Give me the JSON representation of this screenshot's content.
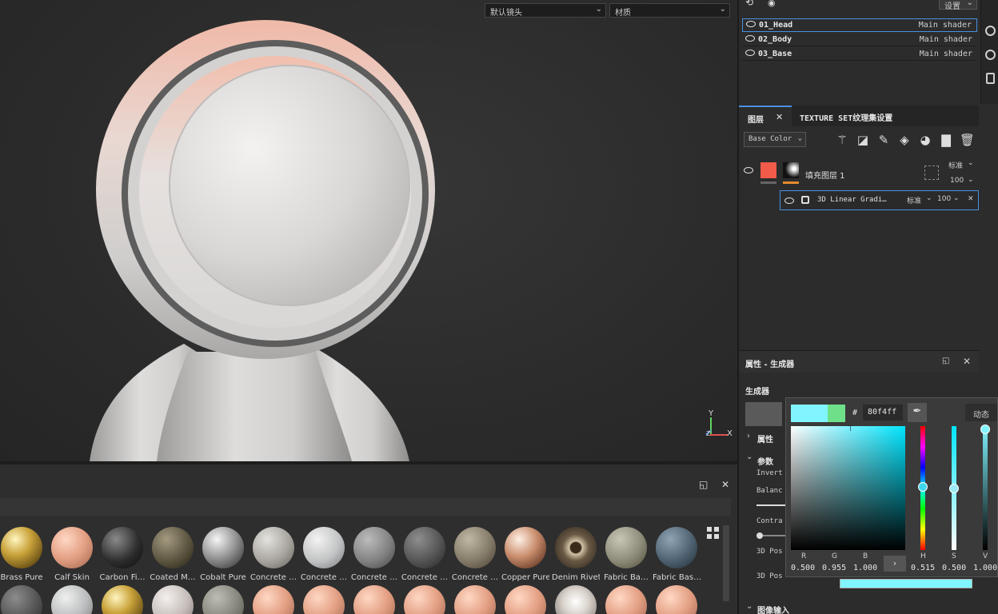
{
  "viewport": {
    "camera_select": "默认镜头",
    "material_select": "材质",
    "axis_y": "Y",
    "axis_x": "X",
    "axis_z": "Z"
  },
  "texture_sets": {
    "settings_label": "设置",
    "items": [
      {
        "name": "01_Head",
        "shader": "Main shader"
      },
      {
        "name": "02_Body",
        "shader": "Main shader"
      },
      {
        "name": "03_Base",
        "shader": "Main shader"
      }
    ]
  },
  "layers": {
    "tab_layers": "图层",
    "tab_texture_set": "TEXTURE SET纹理集设置",
    "channel_select": "Base Color",
    "fill_layer": {
      "name": "填充图层 1",
      "blend": "标准",
      "opacity": "100"
    },
    "sublayer": {
      "name": "3D Linear Gradi…",
      "blend": "标准",
      "opacity": "100"
    }
  },
  "properties": {
    "title": "属性 - 生成器",
    "generator_label": "生成器",
    "section_attributes": "属性",
    "section_params": "参数",
    "param_invert": "Invert",
    "param_balance": "Balanc",
    "param_contrast": "Contra",
    "param_3dpos1": "3D Pos",
    "param_3dpos2": "3D Pos",
    "section_image_input": "图像输入"
  },
  "color_picker": {
    "hash": "#",
    "hex": "80f4ff",
    "dynamic_button": "动态",
    "r_label": "R",
    "g_label": "G",
    "b_label": "B",
    "h_label": "H",
    "s_label": "S",
    "v_label": "V",
    "r": "0.500",
    "g": "0.955",
    "b": "1.000",
    "h": "0.515",
    "s": "0.500",
    "v": "1.000",
    "new_color": "#80f4ff",
    "old_color": "#6fe08a"
  },
  "shelf": {
    "materials_row1": [
      {
        "label": "Brass Pure"
      },
      {
        "label": "Calf Skin"
      },
      {
        "label": "Carbon Fi…"
      },
      {
        "label": "Coated M…"
      },
      {
        "label": "Cobalt Pure"
      },
      {
        "label": "Concrete …"
      },
      {
        "label": "Concrete …"
      },
      {
        "label": "Concrete …"
      },
      {
        "label": "Concrete …"
      },
      {
        "label": "Concrete …"
      },
      {
        "label": "Copper Pure"
      },
      {
        "label": "Denim Rivet"
      },
      {
        "label": "Fabric Ba…"
      },
      {
        "label": "Fabric Bas…"
      }
    ]
  }
}
